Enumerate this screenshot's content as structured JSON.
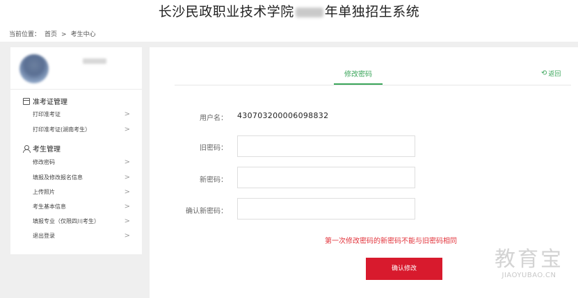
{
  "site": {
    "title_left": "长沙民政职业技术学院",
    "title_right": "年单独招生系统"
  },
  "breadcrumb": {
    "prefix": "当前位置：",
    "home": "首页",
    "sep": ">",
    "current": "考生中心"
  },
  "sidebar": {
    "group1": {
      "icon": "calendar-icon",
      "title": "准考证管理",
      "items": [
        "打印准考证",
        "打印准考证(湖南考生）"
      ]
    },
    "group2": {
      "icon": "user-icon",
      "title": "考生管理",
      "items": [
        "修改密码",
        "填报及修改报名信息",
        "上传照片",
        "考生基本信息",
        "填报专业（仅限四川考生）",
        "退出登录"
      ]
    },
    "chevron": ">"
  },
  "main": {
    "tab": "修改密码",
    "back": "返回",
    "back_icon": "back-arrow-icon",
    "fields": {
      "username_label": "用户名：",
      "username_value": "430703200006098832",
      "old_pw_label": "旧密码：",
      "new_pw_label": "新密码：",
      "confirm_pw_label": "确认新密码："
    },
    "warning": "第一次修改密码的新密码不能与旧密码相同",
    "submit": "确认修改"
  },
  "watermark": {
    "big": "教育宝",
    "small": "JIAOYUBAO.CN"
  },
  "colors": {
    "accent_green": "#3aa55a",
    "button_red": "#d81a2d",
    "warning_red": "#e2333b",
    "page_gray": "#efefef"
  }
}
